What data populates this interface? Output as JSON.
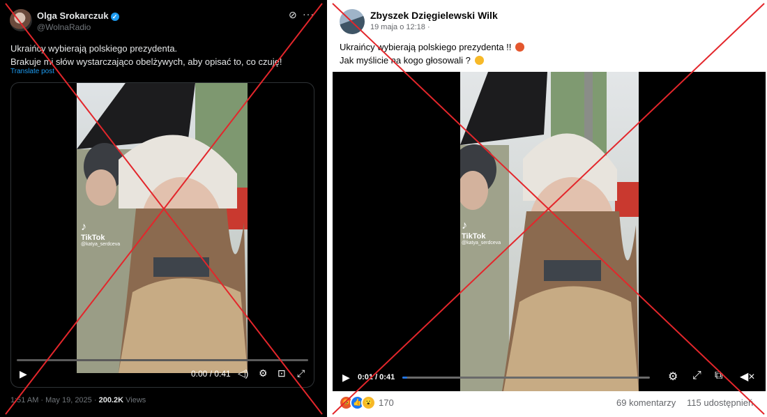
{
  "colors": {
    "x_background": "#000000",
    "x_link": "#1d9bf0",
    "fb_background": "#ffffff",
    "cross": "#e3262b",
    "fb_progress": "#2374e1"
  },
  "x_post": {
    "author_name": "Olga Srokarczuk",
    "handle": "@WolnaRadio",
    "verified_icon": "verified-badge",
    "text_line1": "Ukraińcy wybierają polskiego prezydenta.",
    "text_line2": "Brakuje mi słów wystarczająco obelżywych, aby opisać to, co czuję!",
    "translate_link": "Translate post",
    "video": {
      "watermark": "TikTok",
      "watermark_handle": "@katya_serdceva",
      "time": "0:00 / 0:41"
    },
    "timestamp": "1:51 AM · May 19, 2025 · ",
    "views_count": "200.2K",
    "views_label": " Views"
  },
  "fb_post": {
    "author_name": "Zbyszek Dzięgielewski Wilk",
    "date": "19 maja o 12:18 ·",
    "text_line1": "Ukraińcy wybierają polskiego prezydenta !!",
    "text_line2": "Jak myślicie na kogo głosowali ?",
    "video": {
      "watermark": "TikTok",
      "watermark_handle": "@katya_serdceva",
      "time": "0:01 / 0:41",
      "progress": 0.02
    },
    "reactions_count": "170",
    "comments": "69 komentarzy",
    "shares": "115 udostępnień"
  }
}
